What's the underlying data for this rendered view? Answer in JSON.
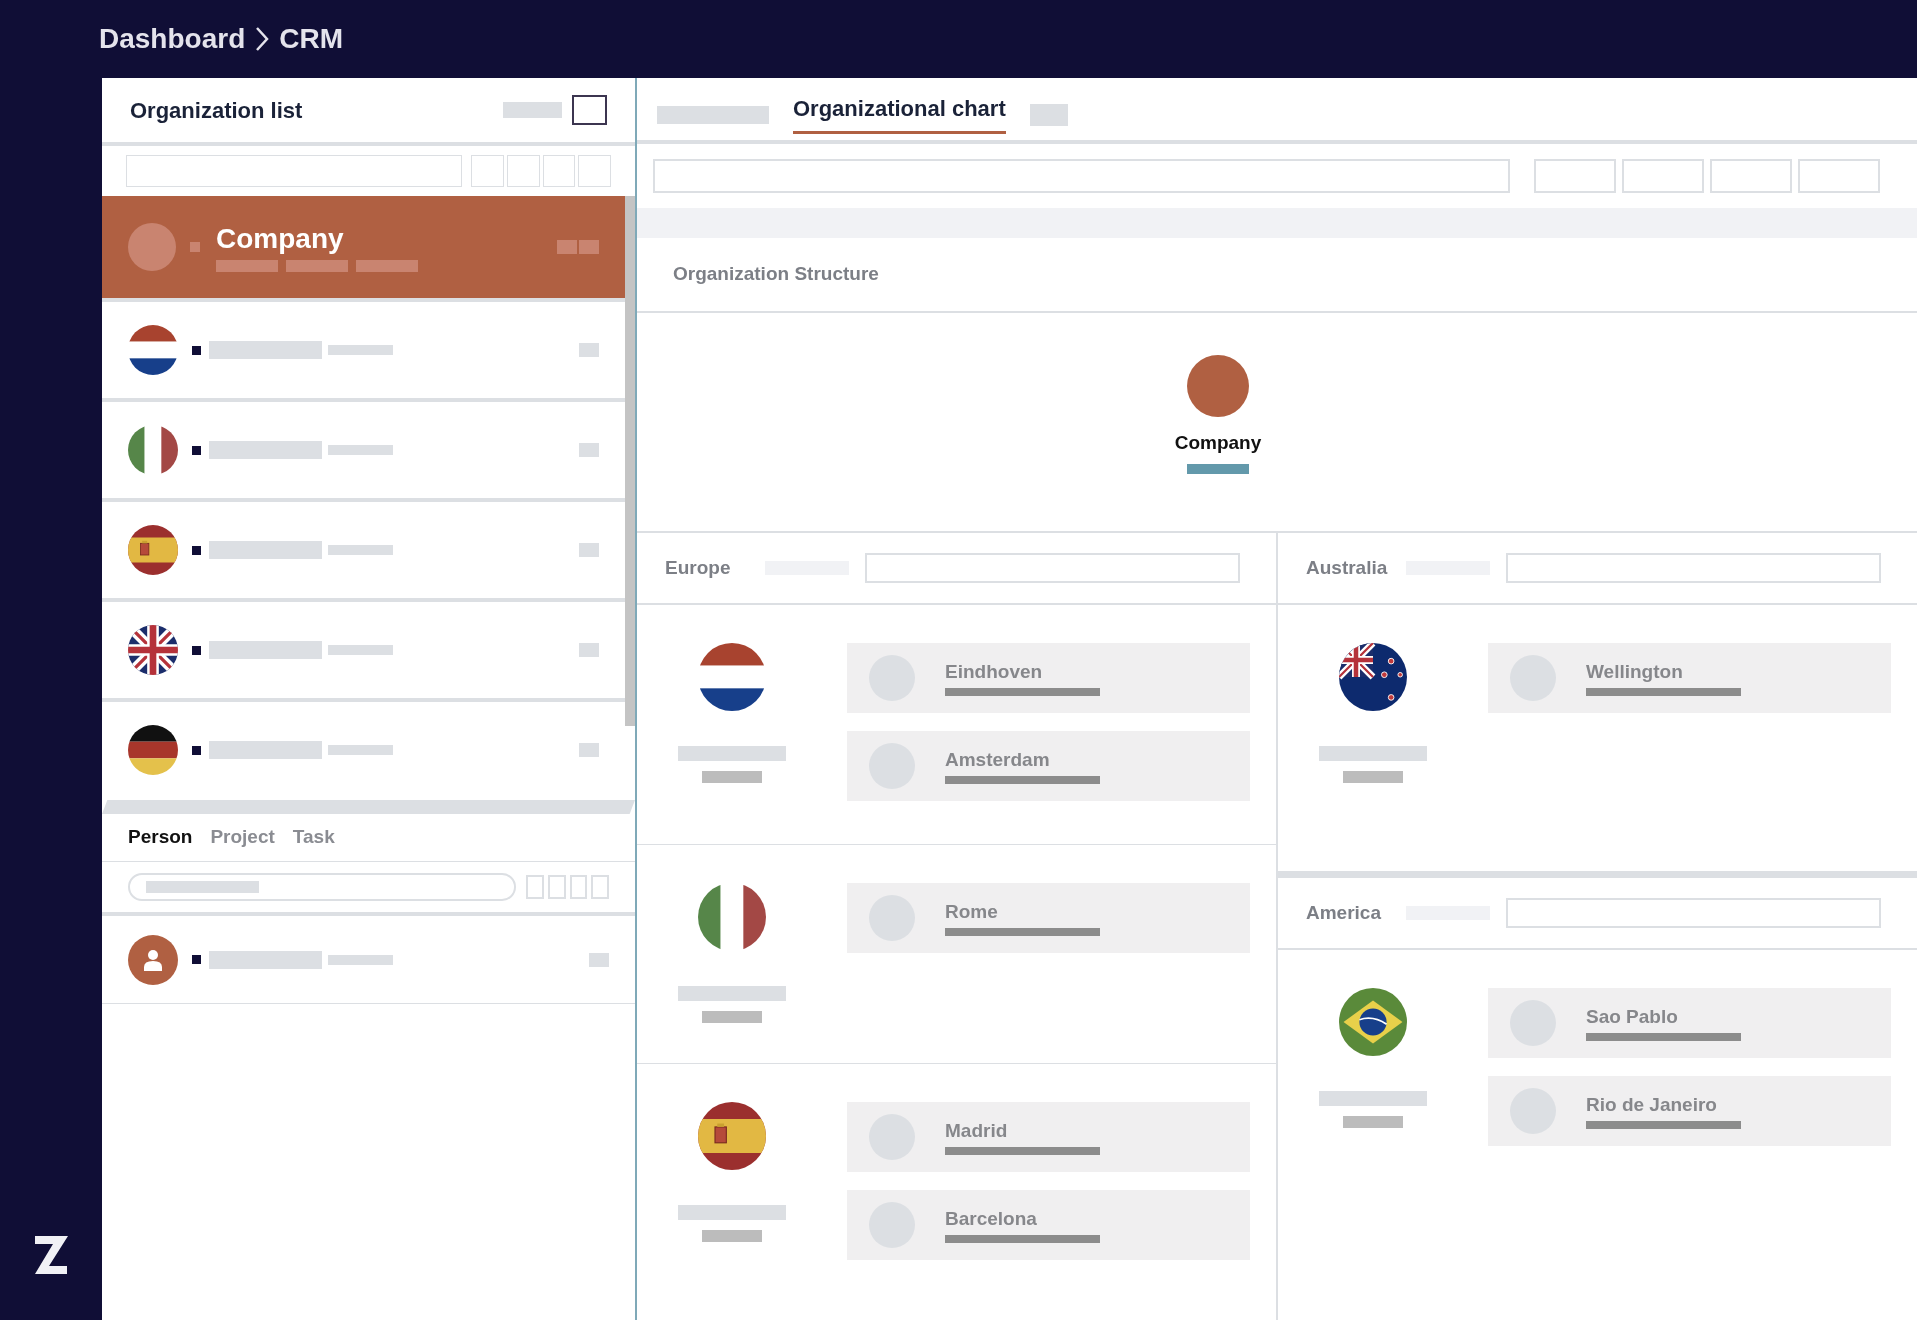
{
  "breadcrumb": [
    "Dashboard",
    "CRM"
  ],
  "organization_list": {
    "title": "Organization list",
    "items": [
      {
        "kind": "company",
        "label": "Company",
        "selected": true
      },
      {
        "kind": "nl",
        "selected": false
      },
      {
        "kind": "it",
        "selected": false
      },
      {
        "kind": "es",
        "selected": false
      },
      {
        "kind": "uk",
        "selected": false
      },
      {
        "kind": "de",
        "selected": false
      }
    ]
  },
  "detail_tabs": [
    {
      "label": "Person",
      "selected": true
    },
    {
      "label": "Project",
      "selected": false
    },
    {
      "label": "Task",
      "selected": false
    }
  ],
  "chart_tabs": [
    {
      "label": "Organizational chart",
      "selected": true
    }
  ],
  "structure": {
    "title": "Organization Structure",
    "root": "Company",
    "columns": [
      [
        {
          "name": "Europe",
          "countries": [
            {
              "kind": "nl",
              "cities": [
                "Eindhoven",
                "Amsterdam"
              ]
            },
            {
              "kind": "it",
              "cities": [
                "Rome"
              ]
            },
            {
              "kind": "es",
              "cities": [
                "Madrid",
                "Barcelona"
              ]
            }
          ]
        }
      ],
      [
        {
          "name": "Australia",
          "countries": [
            {
              "kind": "nz",
              "cities": [
                "Wellington"
              ]
            }
          ]
        },
        {
          "name": "America",
          "countries": [
            {
              "kind": "br",
              "cities": [
                "Sao Pablo",
                "Rio de Janeiro"
              ]
            }
          ]
        }
      ]
    ]
  }
}
